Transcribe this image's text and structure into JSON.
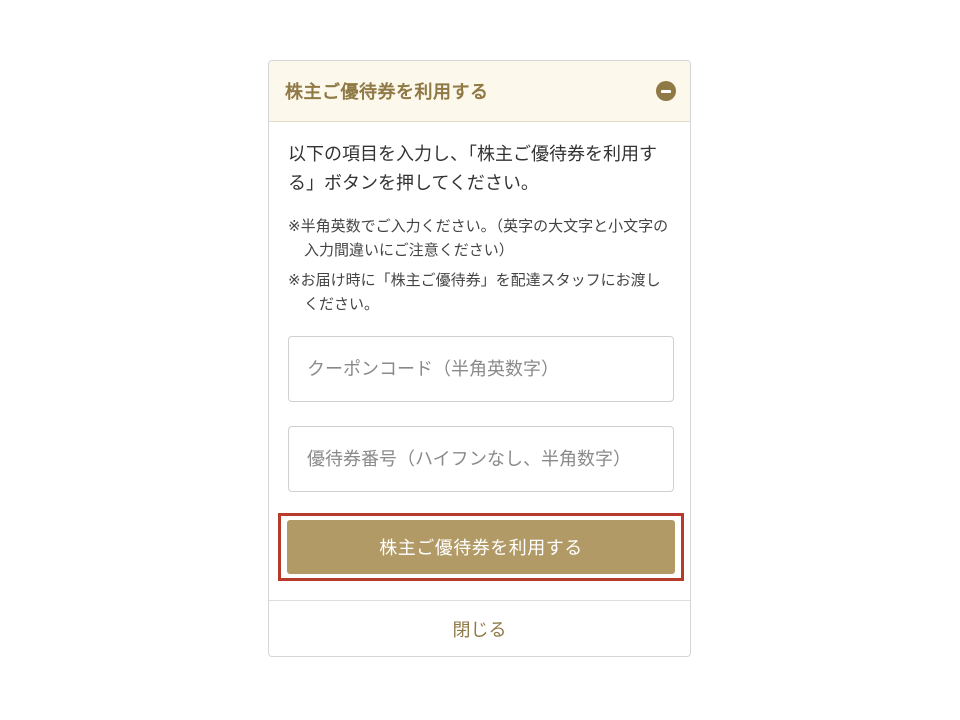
{
  "panel": {
    "title": "株主ご優待券を利用する",
    "collapse_icon": "minus-circle-icon",
    "accent_color": "#8f7945",
    "header_background": "#fdf8ec"
  },
  "body": {
    "lead": "以下の項目を入力し、「株主ご優待券を利用する」ボタンを押してください。",
    "notes": [
      "※半角英数でご入力ください。（英字の大文字と小文字の入力間違いにご注意ください）",
      "※お届け時に「株主ご優待券」を配達スタッフにお渡しください。"
    ]
  },
  "form": {
    "coupon_code_placeholder": "クーポンコード（半角英数字）",
    "coupon_code_value": "",
    "voucher_number_placeholder": "優待券番号（ハイフンなし、半角数字）",
    "voucher_number_value": "",
    "submit_label": "株主ご優待券を利用する",
    "submit_color": "#b19a65",
    "highlight_color": "#b83a2a"
  },
  "footer": {
    "close_label": "閉じる"
  }
}
